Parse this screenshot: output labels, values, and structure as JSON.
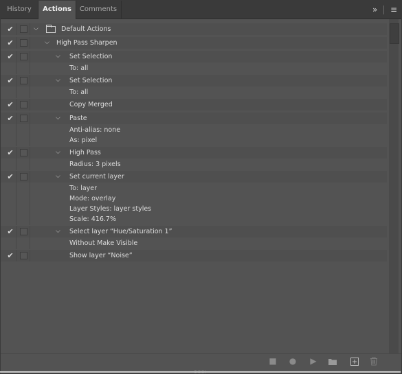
{
  "tabs": [
    {
      "label": "History",
      "active": false
    },
    {
      "label": "Actions",
      "active": true
    },
    {
      "label": "Comments",
      "active": false
    }
  ],
  "tab_icons": {
    "expand": "»",
    "menu": "≡"
  },
  "actions": [
    {
      "kind": "set",
      "checked": true,
      "expanded": true,
      "label": "Default Actions",
      "level": 0
    },
    {
      "kind": "action",
      "checked": true,
      "expanded": true,
      "label": "High Pass Sharpen",
      "level": 1
    },
    {
      "kind": "step",
      "checked": true,
      "expanded": true,
      "label": "Set Selection",
      "level": 2
    },
    {
      "kind": "detail",
      "label": "To: all"
    },
    {
      "kind": "step",
      "checked": true,
      "expanded": true,
      "label": "Set Selection",
      "level": 2
    },
    {
      "kind": "detail",
      "label": "To: all"
    },
    {
      "kind": "step",
      "checked": true,
      "expanded": false,
      "label": "Copy Merged",
      "level": 2
    },
    {
      "kind": "step",
      "checked": true,
      "expanded": true,
      "label": "Paste",
      "level": 2
    },
    {
      "kind": "detail",
      "label": "Anti-alias: none"
    },
    {
      "kind": "detail",
      "label": "As: pixel"
    },
    {
      "kind": "step",
      "checked": true,
      "expanded": true,
      "label": "High Pass",
      "level": 2
    },
    {
      "kind": "detail",
      "label": "Radius: 3 pixels"
    },
    {
      "kind": "step",
      "checked": true,
      "expanded": true,
      "label": "Set current layer",
      "level": 2
    },
    {
      "kind": "detail",
      "label": "To: layer"
    },
    {
      "kind": "detail",
      "label": "Mode: overlay"
    },
    {
      "kind": "detail",
      "label": "Layer Styles: layer styles"
    },
    {
      "kind": "detail",
      "label": "Scale: 416.7%"
    },
    {
      "kind": "step",
      "checked": true,
      "expanded": true,
      "label": "Select layer “Hue/Saturation 1”",
      "level": 2
    },
    {
      "kind": "detail",
      "label": "Without Make Visible"
    },
    {
      "kind": "step",
      "checked": true,
      "expanded": false,
      "label": "Show layer “Noise”",
      "level": 2
    }
  ],
  "bottom_icons": [
    "stop-icon",
    "record-icon",
    "play-icon",
    "new-set-folder-icon",
    "new-action-icon",
    "delete-icon"
  ]
}
